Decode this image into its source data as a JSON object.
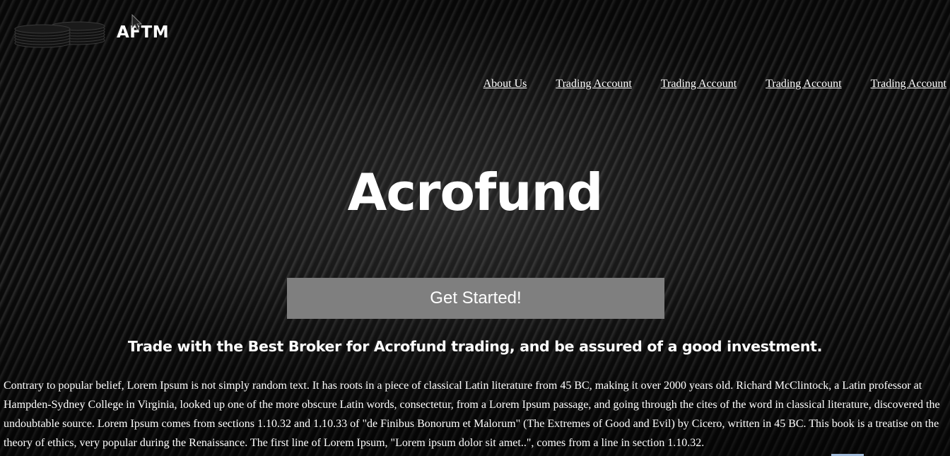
{
  "header": {
    "brand": "AFTM",
    "logo_icon": "coin-stacks-icon"
  },
  "nav": {
    "items": [
      {
        "label": "About Us"
      },
      {
        "label": "Trading Account"
      },
      {
        "label": "Trading Account"
      },
      {
        "label": "Trading Account"
      },
      {
        "label": "Trading Account"
      }
    ]
  },
  "hero": {
    "title": "Acrofund",
    "cta_label": "Get Started!",
    "tagline": "Trade with the Best Broker for Acrofund trading, and be assured of a good investment."
  },
  "content": {
    "paragraph": "Contrary to popular belief, Lorem Ipsum is not simply random text. It has roots in a piece of classical Latin literature from 45 BC, making it over 2000 years old. Richard McClintock, a Latin professor at Hampden-Sydney College in Virginia, looked up one of the more obscure Latin words, consectetur, from a Lorem Ipsum passage, and going through the cites of the word in classical literature, discovered the undoubtable source. Lorem Ipsum comes from sections 1.10.32 and 1.10.33 of \"de Finibus Bonorum et Malorum\" (The Extremes of Good and Evil) by Cicero, written in 45 BC. This book is a treatise on the theory of ethics, very popular during the Renaissance. The first line of Lorem Ipsum, \"Lorem ipsum dolor sit amet..\", comes from a line in section 1.10.32."
  },
  "colors": {
    "background": "#050505",
    "cta_background": "#7f7f7f",
    "text": "#ffffff"
  }
}
